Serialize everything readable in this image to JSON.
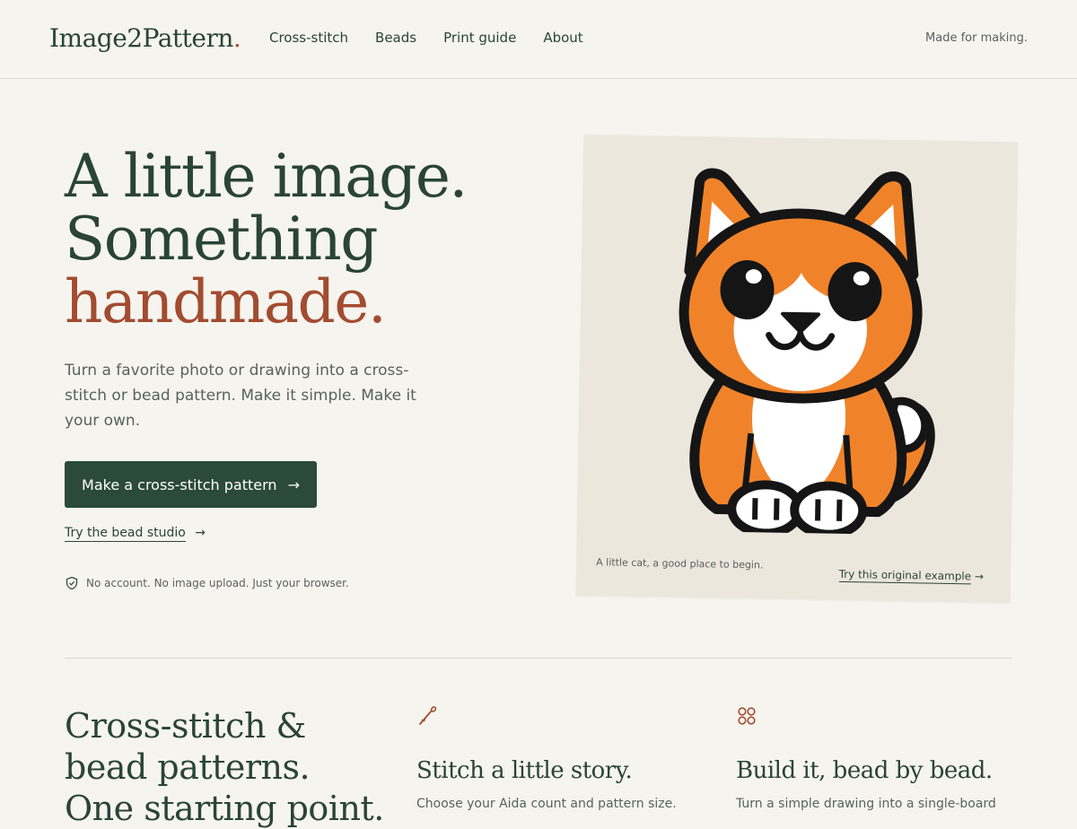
{
  "header": {
    "logo": "Image2Pattern",
    "logo_dot": ".",
    "nav": [
      "Cross-stitch",
      "Beads",
      "Print guide",
      "About"
    ],
    "tagline": "Made for making."
  },
  "hero": {
    "title_line1": "A little image.",
    "title_line2": "Something",
    "title_line3": "handmade.",
    "subtitle": "Turn a favorite photo or drawing into a cross-stitch or bead pattern. Make it simple. Make it your own.",
    "cta_label": "Make a cross-stitch pattern",
    "bead_link": "Try the bead studio",
    "note": "No account. No image upload. Just your browser."
  },
  "card": {
    "caption": "A little cat, a good place to begin.",
    "link": "Try this original example"
  },
  "lower": {
    "title_line1": "Cross-stitch &",
    "title_line2": "bead patterns.",
    "title_line3": "One starting point.",
    "features": [
      {
        "icon": "needle-icon",
        "title": "Stitch a little story.",
        "desc": "Choose your Aida count and pattern size."
      },
      {
        "icon": "beads-icon",
        "title": "Build it, bead by bead.",
        "desc": "Turn a simple drawing into a single-board"
      }
    ]
  },
  "colors": {
    "background": "#f6f4ef",
    "primary": "#2b4a39",
    "accent": "#a24c31",
    "cat_orange": "#f0832a"
  }
}
